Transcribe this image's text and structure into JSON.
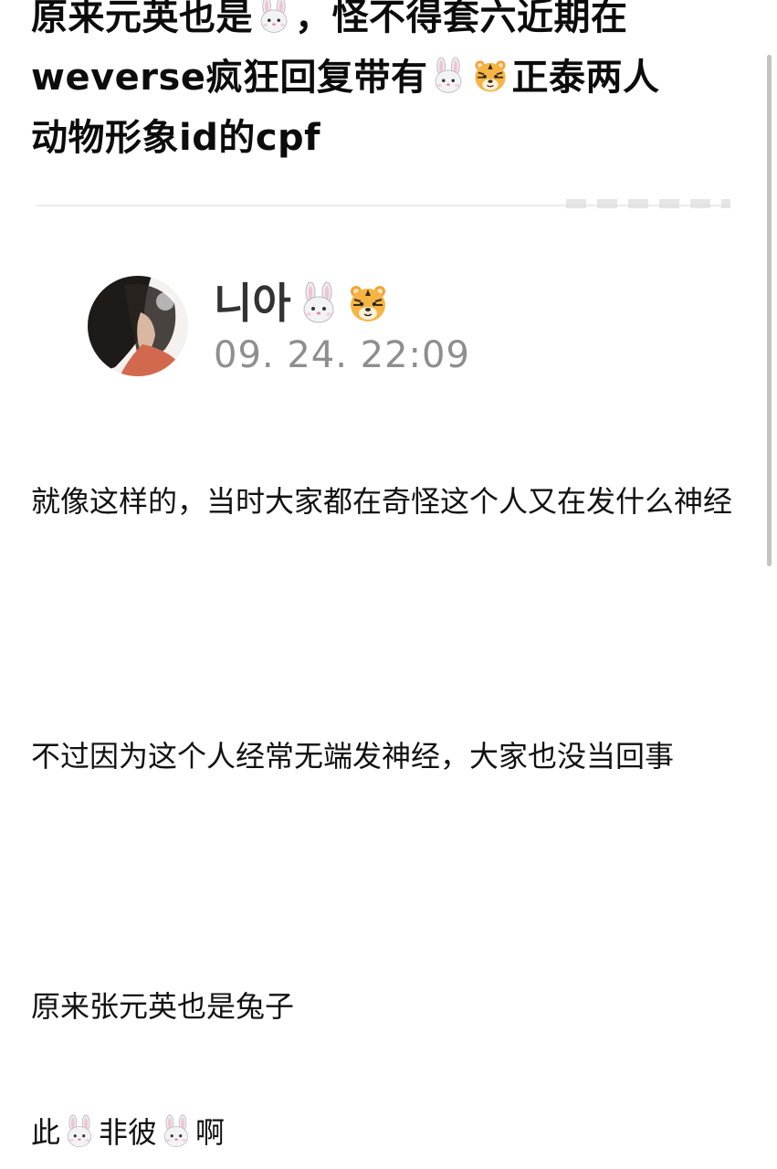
{
  "post": {
    "title_line1_a": "原来元英也是",
    "title_line1_b": "，怪不得套六近期在",
    "title_line2_a": "weverse疯狂回复带有",
    "title_line2_b": "正泰两人",
    "title_line3": "动物形象id的cpf"
  },
  "embed": {
    "username": "니아",
    "timestamp": "09. 24. 22:09"
  },
  "paragraphs": {
    "p1": "就像这样的，当时大家都在奇怪这个人又在发什么神经",
    "p2": "不过因为这个人经常无端发神经，大家也没当回事",
    "p3": "原来张元英也是兔子",
    "p4_a": "此",
    "p4_b": "非彼",
    "p4_c": "啊"
  },
  "icons": {
    "rabbit": "rabbit-face-icon",
    "tiger": "tiger-face-icon"
  }
}
